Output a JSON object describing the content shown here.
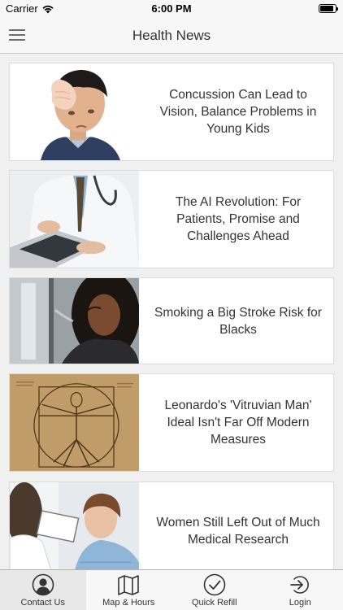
{
  "status_bar": {
    "carrier": "Carrier",
    "time": "6:00 PM",
    "battery_level": 0.9,
    "icons": [
      "wifi-icon",
      "battery-icon"
    ]
  },
  "nav": {
    "title": "Health News",
    "menu_icon": "hamburger-menu-icon"
  },
  "articles": [
    {
      "title": "Concussion Can Lead to Vision, Balance Problems in Young Kids",
      "image": "boy-holding-head"
    },
    {
      "title": "The AI Revolution: For Patients, Promise and Challenges Ahead",
      "image": "doctor-with-laptop"
    },
    {
      "title": "Smoking a Big Stroke Risk for Blacks",
      "image": "woman-smoking"
    },
    {
      "title": "Leonardo's 'Vitruvian Man' Ideal Isn't Far Off Modern Measures",
      "image": "vitruvian-man-drawing"
    },
    {
      "title": "Women Still Left Out of Much Medical Research",
      "image": "patient-and-doctor"
    }
  ],
  "tabs": [
    {
      "label": "Contact Us",
      "icon": "person-icon"
    },
    {
      "label": "Map & Hours",
      "icon": "map-icon"
    },
    {
      "label": "Quick Refill",
      "icon": "checkmark-circle-icon"
    },
    {
      "label": "Login",
      "icon": "login-icon"
    }
  ],
  "active_tab": "Contact Us",
  "colors": {
    "bar_background": "#f7f7f7",
    "feed_background": "#f0f0f0",
    "card_background": "#ffffff",
    "text": "#333333"
  }
}
